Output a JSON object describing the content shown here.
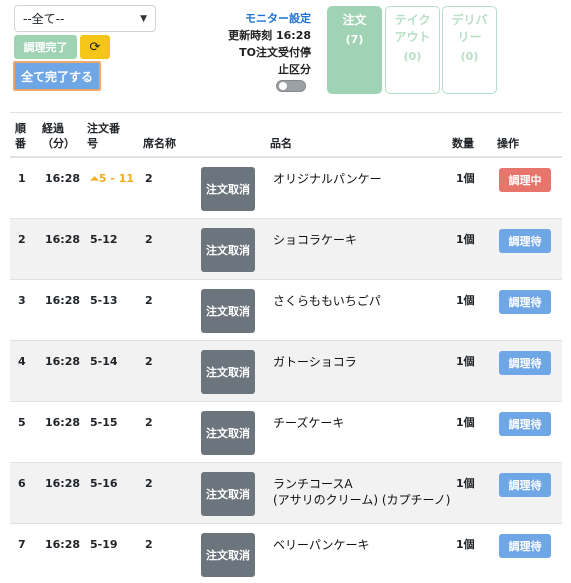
{
  "toolbar": {
    "filter_value": "--全て--",
    "complete_label": "調理完了",
    "refresh_icon": "refresh-icon",
    "complete_all_label": "全て完了する"
  },
  "monitor": {
    "settings_link": "モニター設定",
    "update_time": "更新時刻 16:28",
    "to_stop_line1": "TO注文受付停",
    "to_stop_line2": "止区分"
  },
  "tabs": [
    {
      "label": "注文",
      "count": "(7)"
    },
    {
      "label": "テイクアウト",
      "count": "(0)"
    },
    {
      "label": "デリバリー",
      "count": "(0)"
    }
  ],
  "table": {
    "headers": {
      "no": "順番",
      "elapsed": "経過（分）",
      "order_no": "注文番号",
      "seat": "席名称",
      "item": "品名",
      "qty": "数量",
      "ops": "操作"
    },
    "cancel_label": "注文取消",
    "rows": [
      {
        "no": "1",
        "elapsed": "16:28",
        "order_no": "5 - 11",
        "seat": "2",
        "item": "オリジナルパンケー",
        "qty": "1個",
        "status": "調理中"
      },
      {
        "no": "2",
        "elapsed": "16:28",
        "order_no": "5-12",
        "seat": "2",
        "item": "ショコラケーキ",
        "qty": "1個",
        "status": "調理待"
      },
      {
        "no": "3",
        "elapsed": "16:28",
        "order_no": "5-13",
        "seat": "2",
        "item": "さくらももいちごパ",
        "qty": "1個",
        "status": "調理待"
      },
      {
        "no": "4",
        "elapsed": "16:28",
        "order_no": "5-14",
        "seat": "2",
        "item": "ガトーショコラ",
        "qty": "1個",
        "status": "調理待"
      },
      {
        "no": "5",
        "elapsed": "16:28",
        "order_no": "5-15",
        "seat": "2",
        "item": "チーズケーキ",
        "qty": "1個",
        "status": "調理待"
      },
      {
        "no": "6",
        "elapsed": "16:28",
        "order_no": "5-16",
        "seat": "2",
        "item": "ランチコースA",
        "item_sub": "(アサリのクリーム) (カプチーノ)",
        "qty": "1個",
        "status": "調理待"
      },
      {
        "no": "7",
        "elapsed": "16:28",
        "order_no": "5-19",
        "seat": "2",
        "item": "ベリーパンケーキ",
        "qty": "1個",
        "status": "調理待"
      }
    ]
  },
  "colors": {
    "green_accent": "#9fd3b3",
    "blue_button": "#6fa6e6",
    "red_button": "#e8756b",
    "cancel_gray": "#6c757d",
    "alert_orange": "#f0ad1e"
  }
}
